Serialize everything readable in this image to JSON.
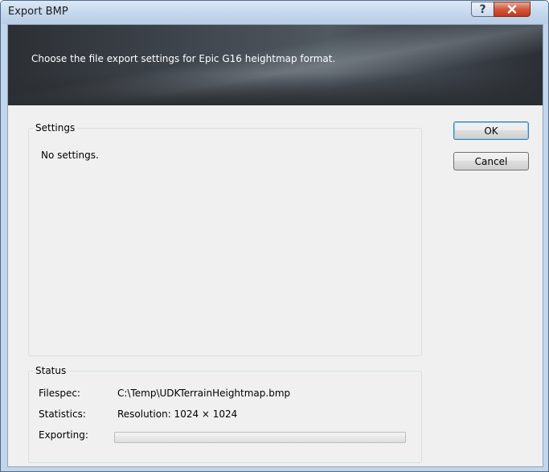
{
  "window": {
    "title": "Export BMP",
    "help_glyph": "?",
    "close_glyph": "x"
  },
  "banner": {
    "text": "Choose the file export settings for Epic G16 heightmap format."
  },
  "settings": {
    "legend": "Settings",
    "empty_text": "No settings."
  },
  "status": {
    "legend": "Status",
    "filespec_label": "Filespec:",
    "filespec_value": "C:\\Temp\\UDKTerrainHeightmap.bmp",
    "statistics_label": "Statistics:",
    "statistics_value": "Resolution: 1024 × 1024",
    "exporting_label": "Exporting:",
    "progress": 0
  },
  "buttons": {
    "ok": "OK",
    "cancel": "Cancel"
  },
  "colors": {
    "titlebar": "#c4d7ec",
    "close_button": "#c0391e",
    "banner": "#3d434a",
    "dialog_bg": "#f0f0f0"
  }
}
